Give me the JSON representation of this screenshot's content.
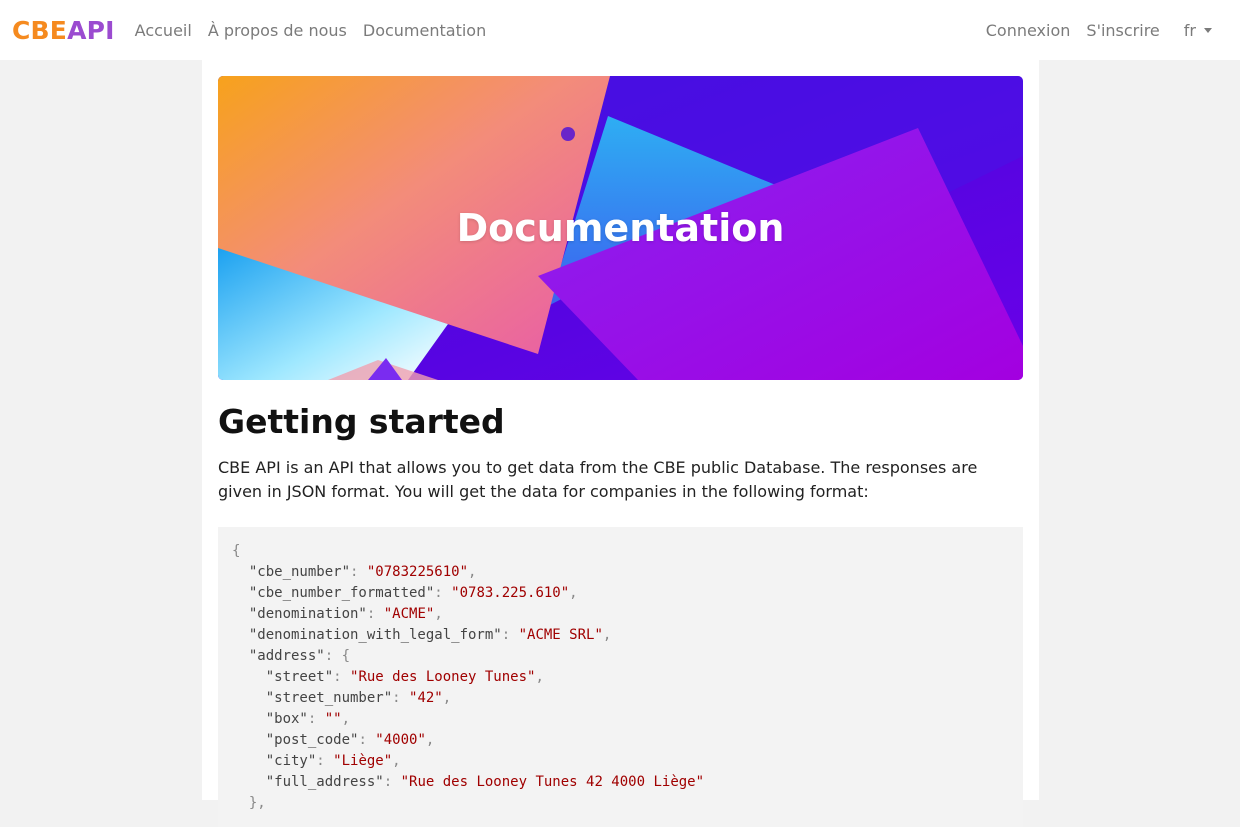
{
  "navbar": {
    "brand_part1": "CBE",
    "brand_part2": "API",
    "links": [
      "Accueil",
      "À propos de nous",
      "Documentation"
    ],
    "login": "Connexion",
    "signup": "S'inscrire",
    "language": "fr"
  },
  "hero": {
    "title": "Documentation"
  },
  "content": {
    "heading": "Getting started",
    "intro": "CBE API is an API that allows you to get data from the CBE public Database. The responses are given in JSON format. You will get the data for companies in the following format:"
  },
  "code": {
    "open": "{",
    "fields": [
      {
        "key": "\"cbe_number\"",
        "value": "\"0783225610\""
      },
      {
        "key": "\"cbe_number_formatted\"",
        "value": "\"0783.225.610\""
      },
      {
        "key": "\"denomination\"",
        "value": "\"ACME\""
      },
      {
        "key": "\"denomination_with_legal_form\"",
        "value": "\"ACME SRL\""
      }
    ],
    "address_key": "\"address\"",
    "address_fields": [
      {
        "key": "\"street\"",
        "value": "\"Rue des Looney Tunes\""
      },
      {
        "key": "\"street_number\"",
        "value": "\"42\""
      },
      {
        "key": "\"box\"",
        "value": "\"\""
      },
      {
        "key": "\"post_code\"",
        "value": "\"4000\""
      },
      {
        "key": "\"city\"",
        "value": "\"Liège\""
      },
      {
        "key": "\"full_address\"",
        "value": "\"Rue des Looney Tunes 42 4000 Liège\""
      }
    ],
    "close_nested": "},"
  },
  "colors": {
    "brand_orange": "#f58a1f",
    "brand_purple": "#9b4bd0",
    "code_string": "#a00000"
  }
}
